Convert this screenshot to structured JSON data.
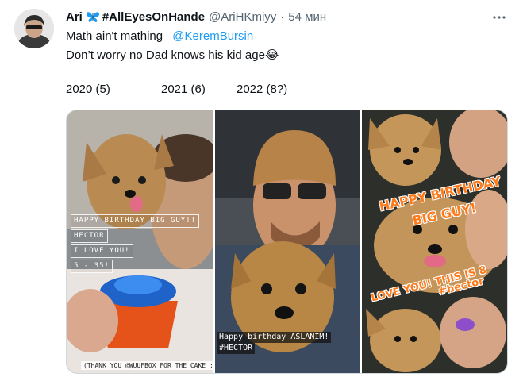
{
  "tweet": {
    "display_name": "Ari",
    "display_name_tag": "#AllEyesOnHande",
    "handle": "@AriHKmiyy",
    "separator": "·",
    "time": "54 мин",
    "more_icon": "more-horizontal-icon",
    "butterfly_icon": "butterfly-emoji",
    "text_line1": "Math ain't mathing",
    "mention": "@KeremBursin",
    "text_line2": "Don’t worry no Dad knows his kid age",
    "emoji": "😂",
    "years": [
      "2020  (5)",
      "2021  (6)",
      "2022 (8?)"
    ]
  },
  "media": {
    "panel1": {
      "lines": [
        "HAPPY BIRTHDAY BIG GUY!!",
        "HECTOR",
        "I LOVE YOU!",
        "5 - 35!"
      ],
      "caption": "(THANK YOU @WUUFBOX FOR THE CAKE ;)"
    },
    "panel2": {
      "line1": "Happy birthday ASLANIM!",
      "line2": "#HECTOR"
    },
    "panel3": {
      "line1": "HAPPY BIRTHDAY",
      "line2": "BIG GUY!",
      "line3": "LOVE YOU! THIS IS 8",
      "line4": "#hector"
    }
  },
  "colors": {
    "text": "#0f1419",
    "secondary": "#536471",
    "link": "#1d9bf0",
    "overlay_orange": "#ff7a1a"
  }
}
